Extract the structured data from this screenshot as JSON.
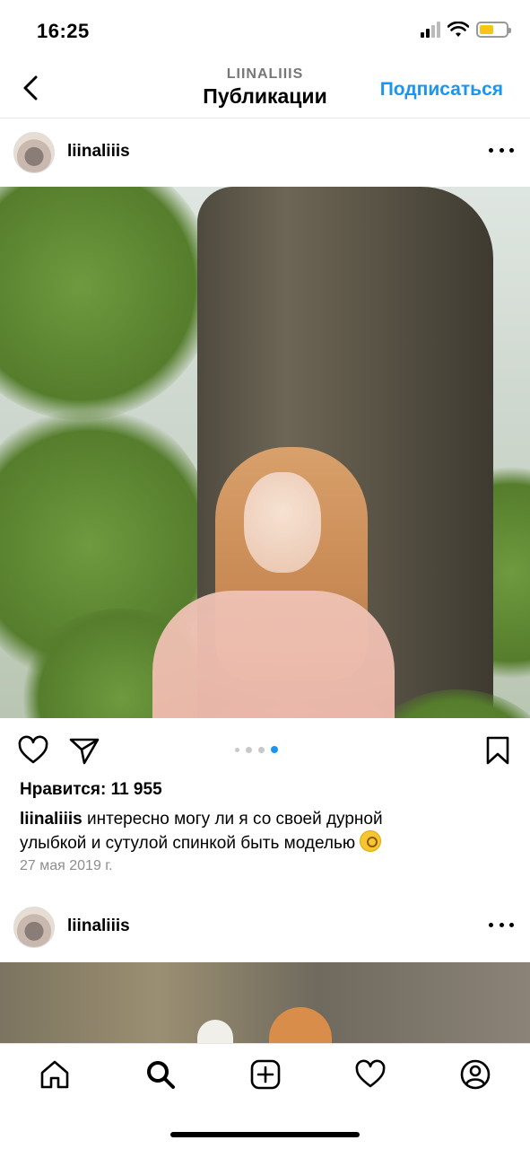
{
  "status_bar": {
    "time": "16:25",
    "battery_level": 0.55,
    "battery_color": "#f5c518"
  },
  "header": {
    "back_icon": "chevron-left-icon",
    "subtitle": "LIINALIIIS",
    "title": "Публикации",
    "follow_label": "Подписаться",
    "follow_color": "#1a96f0"
  },
  "posts": [
    {
      "username": "liinaliiis",
      "carousel": {
        "count": 4,
        "active": 4
      },
      "likes_label": "Нравится: 11 955",
      "caption_user": "liinaliiis",
      "caption_text": " интересно могу ли я со своей дурной улыбкой и сутулой спинкой быть моделью ",
      "caption_emoji": "face-with-monocle-emoji",
      "date": "27 мая 2019 г."
    },
    {
      "username": "liinaliiis"
    }
  ],
  "actions": {
    "like_icon": "heart-icon",
    "share_icon": "send-icon",
    "save_icon": "bookmark-icon"
  },
  "tab_bar": [
    "home-icon",
    "search-icon",
    "add-post-icon",
    "activity-heart-icon",
    "profile-icon"
  ]
}
